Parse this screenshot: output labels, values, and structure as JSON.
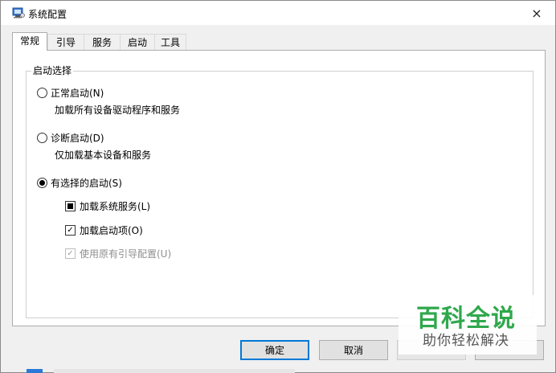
{
  "window": {
    "title": "系统配置",
    "close_glyph": "×"
  },
  "tabs": [
    {
      "label": "常规",
      "active": true
    },
    {
      "label": "引导",
      "active": false
    },
    {
      "label": "服务",
      "active": false
    },
    {
      "label": "启动",
      "active": false
    },
    {
      "label": "工具",
      "active": false
    }
  ],
  "startup": {
    "group_label": "启动选择",
    "normal": {
      "label": "正常启动(N)",
      "desc": "加载所有设备驱动程序和服务",
      "selected": false
    },
    "diagnostic": {
      "label": "诊断启动(D)",
      "desc": "仅加载基本设备和服务",
      "selected": false
    },
    "selective": {
      "label": "有选择的启动(S)",
      "selected": true
    },
    "options": [
      {
        "label": "加载系统服务(L)",
        "state": "indeterminate",
        "enabled": true
      },
      {
        "label": "加载启动项(O)",
        "state": "checked",
        "enabled": true
      },
      {
        "label": "使用原有引导配置(U)",
        "state": "checked",
        "enabled": false
      }
    ]
  },
  "buttons": {
    "ok": "确定",
    "cancel": "取消"
  },
  "watermark": {
    "title": "百科全说",
    "subtitle": "助你轻松解决"
  },
  "icons": {
    "app": "msconfig-icon",
    "close": "close-icon",
    "check": "✓"
  },
  "colors": {
    "accent": "#0078d7",
    "watermark_green": "#2fa84c"
  }
}
